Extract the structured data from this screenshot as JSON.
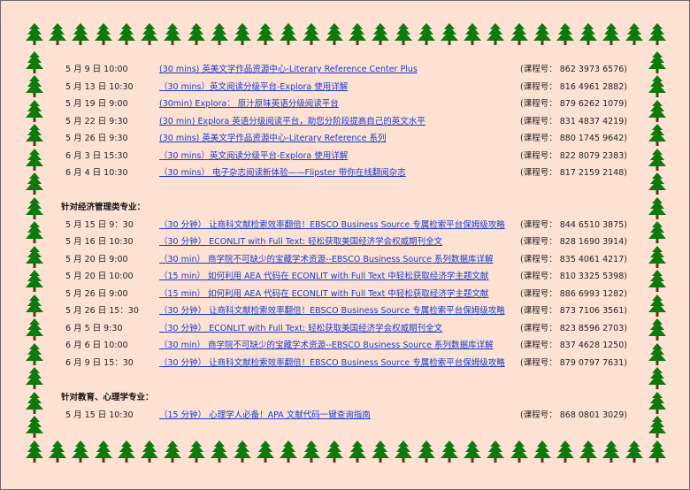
{
  "colors": {
    "background": "#fde2d4",
    "tree": "#0c7a0c",
    "trunk": "#5a3a14",
    "link": "#1a3ccc"
  },
  "border_icon": "christmas-tree-icon",
  "sections": [
    {
      "heading": "",
      "rows": [
        {
          "date": "5 月 9 日 10:00",
          "title": "(30 mins) 英美文学作品资源中心-Literary Reference Center Plus",
          "code": "(课程号： 862 3973 6576)"
        },
        {
          "date": "5 月 13 日 10:30",
          "title": "（30 mins）英文阅读分级平台-Explora 使用详解",
          "code": "(课程号： 816 4961 2882)"
        },
        {
          "date": "5 月 19 日 9:00",
          "title": "(30min) Explora： 原汁原味英语分级阅读平台",
          "code": "(课程号： 879 6262 1079)"
        },
        {
          "date": "5 月 22 日 9:30",
          "title": "(30 min) Explora 英语分级阅读平台，助您分阶段提高自己的英文水平",
          "code": "(课程号： 831 4837 4219)"
        },
        {
          "date": "5 月 26 日 9:30",
          "title": "(30 mins) 英美文学作品资源中心-Literary Reference  系列",
          "code": "(课程号： 880 1745 9642)"
        },
        {
          "date": "6 月 3 日 15:30",
          "title": "（30 mins）英文阅读分级平台-Explora 使用详解",
          "code": "(课程号： 822 8079 2383)"
        },
        {
          "date": "6 月 4 日 10:30",
          "title": "（30 mins） 电子杂志阅读新体验——Flipster 带你在线翻阅杂志",
          "code": "(课程号： 817 2159 2148)"
        }
      ]
    },
    {
      "heading": "针对经济管理类专业：",
      "rows": [
        {
          "date": "5 月 15 日  9：30",
          "title": "（30 分钟） 让商科文献检索效率翻倍！EBSCO Business Source 专属检索平台保姆级攻略",
          "code": "(课程号： 844 6510 3875)"
        },
        {
          "date": "5 月 16 日  10:30",
          "title": "（30 分钟） ECONLIT with Full Text: 轻松获取美国经济学会权威期刊全文",
          "code": "(课程号： 828 1690 3914)"
        },
        {
          "date": "5 月 20 日  9:00",
          "title": "（30 min） 商学院不可缺少的宝藏学术资源--EBSCO Business Source 系列数据库详解",
          "code": "(课程号： 835 4061 4217)"
        },
        {
          "date": "5 月 20 日  10:00",
          "title": "（15 min） 如何利用 AEA 代码在 ECONLIT with Full Text 中轻松获取经济学主题文献",
          "code": "(课程号： 810 3325 5398)"
        },
        {
          "date": "5 月 26 日  9:00",
          "title": "（15 min） 如何利用 AEA 代码在 ECONLIT with Full Text 中轻松获取经济学主题文献",
          "code": "(课程号： 886 6993 1282)"
        },
        {
          "date": "5 月 26 日  15：30",
          "title": "（30 分钟） 让商科文献检索效率翻倍！EBSCO Business Source 专属检索平台保姆级攻略",
          "code": "(课程号： 873 7106 3561)"
        },
        {
          "date": "6 月 5 日  9:30",
          "title": "（30 分钟） ECONLIT with Full Text: 轻松获取美国经济学会权威期刊全文",
          "code": "(课程号： 823 8596 2703)"
        },
        {
          "date": "6 月 6 日  10:00",
          "title": "（30 min） 商学院不可缺少的宝藏学术资源--EBSCO Business Source 系列数据库详解",
          "code": "(课程号： 837 4628 1250)"
        },
        {
          "date": "6 月 9 日  15：30",
          "title": "（30 分钟） 让商科文献检索效率翻倍！EBSCO Business Source 专属检索平台保姆级攻略",
          "code": "(课程号： 879 0797 7631)"
        }
      ]
    },
    {
      "heading": "针对教育、心理学专业：",
      "rows": [
        {
          "date": "5 月 15 日  10:30",
          "title": "（15 分钟） 心理学人必备！APA 文献代码一键查询指南",
          "code": "(课程号： 868 0801 3029)"
        }
      ]
    }
  ]
}
